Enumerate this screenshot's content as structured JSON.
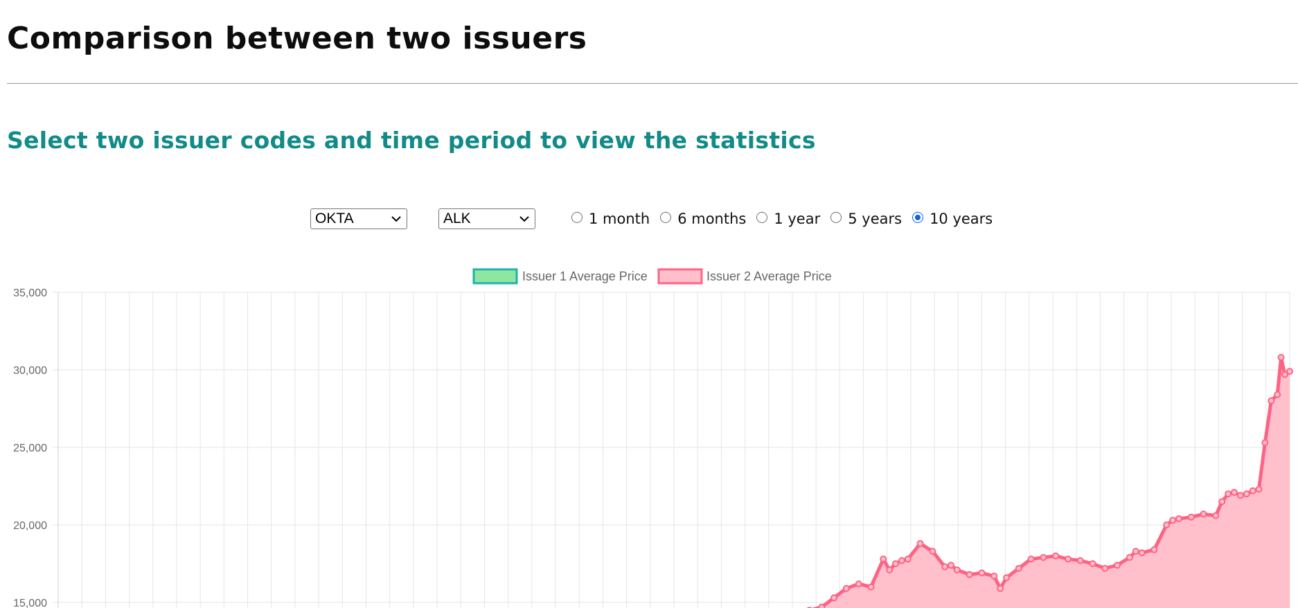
{
  "header": {
    "title": "Comparison between two issuers",
    "subtitle": "Select two issuer codes and time period to view the statistics"
  },
  "controls": {
    "issuer1": "OKTA",
    "issuer2": "ALK",
    "periods": [
      {
        "label": "1 month",
        "checked": false
      },
      {
        "label": "6 months",
        "checked": false
      },
      {
        "label": "1 year",
        "checked": false
      },
      {
        "label": "5 years",
        "checked": false
      },
      {
        "label": "10 years",
        "checked": true
      }
    ]
  },
  "colors": {
    "issuer1_fill": "#8ee7a0",
    "issuer1_border": "#20b2aa",
    "issuer2_fill": "#ffc0cb",
    "issuer2_border": "#ff6384",
    "accent": "#128b88",
    "grid": "#e5e5e5"
  },
  "chart_data": {
    "type": "area",
    "y_ticks": [
      "35,000",
      "30,000",
      "25,000",
      "20,000",
      "15,000"
    ],
    "ylim": [
      15000,
      35000
    ],
    "grid": true,
    "legend_position": "top-center",
    "x_gridlines": 52,
    "series": [
      {
        "name": "Issuer 1 Average Price",
        "values": []
      },
      {
        "name": "Issuer 2 Average Price",
        "x": [
          0.61,
          0.62,
          0.63,
          0.64,
          0.65,
          0.66,
          0.67,
          0.675,
          0.68,
          0.685,
          0.69,
          0.7,
          0.71,
          0.72,
          0.725,
          0.73,
          0.74,
          0.75,
          0.76,
          0.765,
          0.77,
          0.78,
          0.79,
          0.8,
          0.81,
          0.82,
          0.83,
          0.84,
          0.85,
          0.86,
          0.87,
          0.875,
          0.88,
          0.89,
          0.9,
          0.905,
          0.91,
          0.92,
          0.93,
          0.94,
          0.945,
          0.95,
          0.955,
          0.96,
          0.965,
          0.97,
          0.975,
          0.98,
          0.985,
          0.99,
          0.993,
          0.996,
          1.0
        ],
        "values": [
          14500,
          14700,
          15300,
          15900,
          16200,
          16000,
          17800,
          17100,
          17500,
          17700,
          17800,
          18800,
          18300,
          17300,
          17400,
          17100,
          16800,
          16900,
          16700,
          15900,
          16600,
          17200,
          17800,
          17900,
          18000,
          17800,
          17700,
          17500,
          17200,
          17400,
          17900,
          18300,
          18200,
          18400,
          20000,
          20300,
          20400,
          20500,
          20700,
          20600,
          21500,
          22000,
          22100,
          21900,
          22000,
          22200,
          22300,
          25300,
          28000,
          28400,
          30800,
          29700,
          29900
        ]
      }
    ]
  }
}
